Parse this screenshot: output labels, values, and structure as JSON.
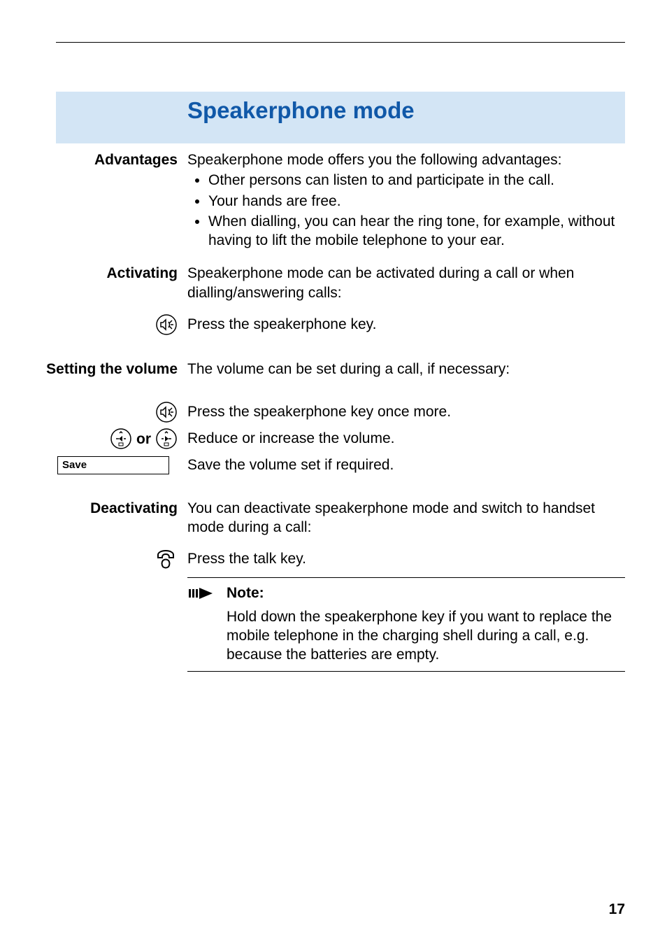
{
  "heading": "Speakerphone mode",
  "advantages_label": "Advantages",
  "advantages_intro": "Speakerphone mode offers you the following advantages:",
  "advantages_items": [
    "Other persons can listen to and participate in the call.",
    "Your hands are free.",
    "When dialling, you can hear the ring tone, for example, without having to lift the mobile telephone to your ear."
  ],
  "activating_label": "Activating",
  "activating_text": "Speakerphone mode can be activated during a call or when dialling/answering calls:",
  "press_speaker": "Press the speakerphone key.",
  "setting_volume_label": "Setting the volume",
  "setting_volume_text": "The volume can be set during a call, if necessary:",
  "press_speaker_again": "Press the speakerphone key once more.",
  "or_label": "or",
  "reduce_increase": "Reduce or increase the volume.",
  "save_key_label": "Save",
  "save_text": "Save the volume set if required.",
  "deactivating_label": "Deactivating",
  "deactivating_text": "You can deactivate speakerphone mode and switch to handset mode during a call:",
  "press_talk": "Press the talk key.",
  "note_title": "Note:",
  "note_body": "Hold down the speakerphone key if you want to replace the mobile telephone in the charging shell during a call, e.g. because the batteries are empty.",
  "page_number": "17"
}
